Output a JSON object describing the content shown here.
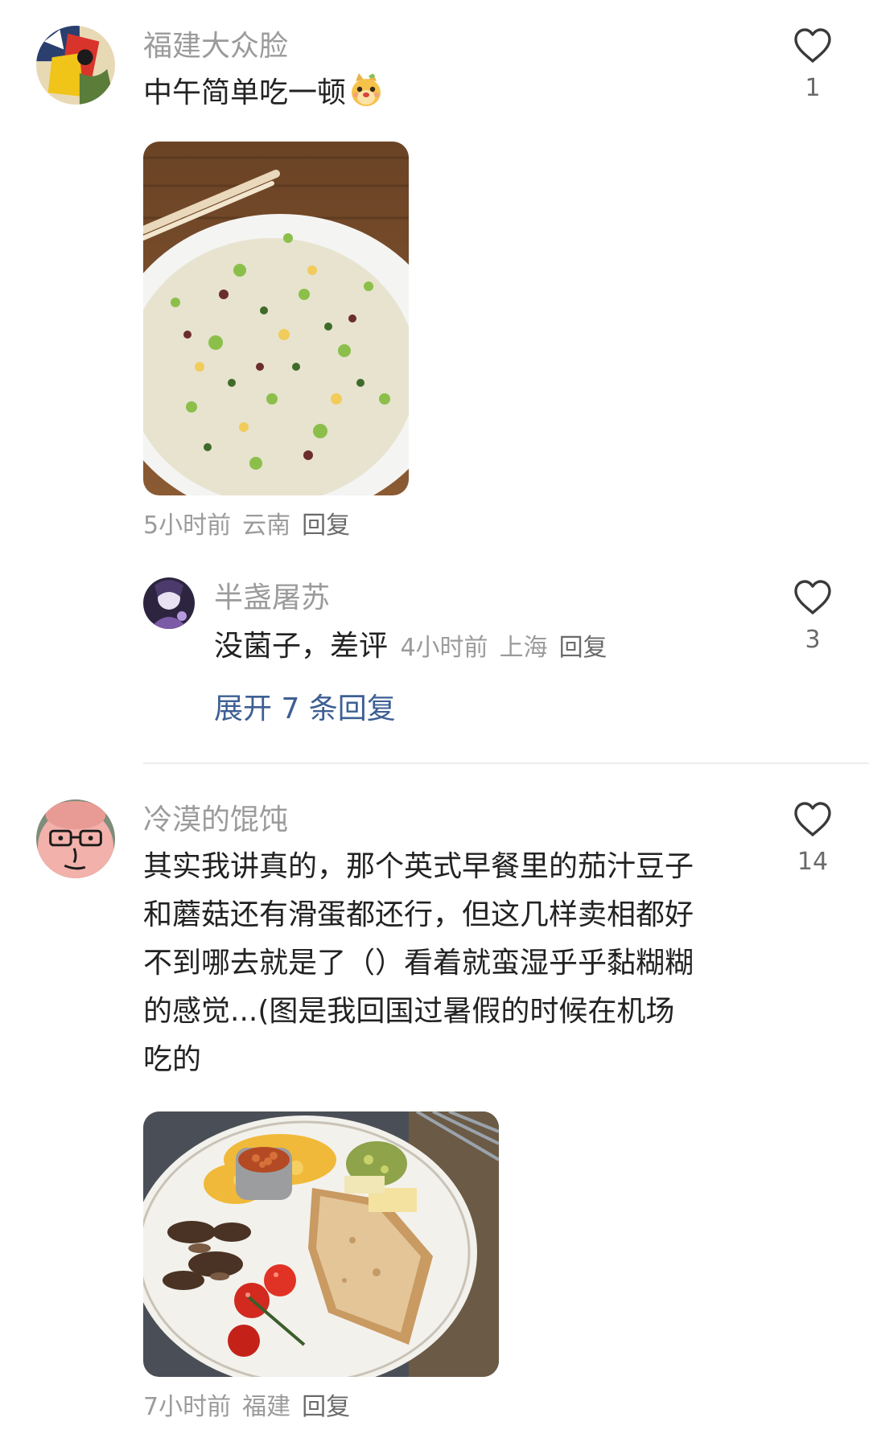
{
  "comments": [
    {
      "username": "福建大众脸",
      "text": "中午简单吃一顿",
      "emoji_icon": "puppy-emoji-icon",
      "time": "5小时前",
      "location": "云南",
      "reply_label": "回复",
      "likes": "1",
      "photo": "fried-rice-photo",
      "replies": [
        {
          "username": "半盏屠苏",
          "text": "没菌子，差评",
          "time": "4小时前",
          "location": "上海",
          "reply_label": "回复",
          "likes": "3"
        }
      ],
      "expand_label": "展开 7 条回复"
    },
    {
      "username": "冷漠的馄饨",
      "text_lines": [
        "其实我讲真的，那个英式早餐里的茄汁豆子",
        "和蘑菇还有滑蛋都还行，但这几样卖相都好",
        "不到哪去就是了（）看着就蛮湿乎乎黏糊糊",
        "的感觉...(图是我回国过暑假的时候在机场",
        "吃的"
      ],
      "time": "7小时前",
      "location": "福建",
      "reply_label": "回复",
      "likes": "14",
      "photo": "english-breakfast-photo"
    }
  ],
  "colors": {
    "username": "#9b9b9b",
    "text": "#222222",
    "meta": "#9b9b9b",
    "expand_link": "#3d5f93",
    "divider": "#ececec"
  }
}
